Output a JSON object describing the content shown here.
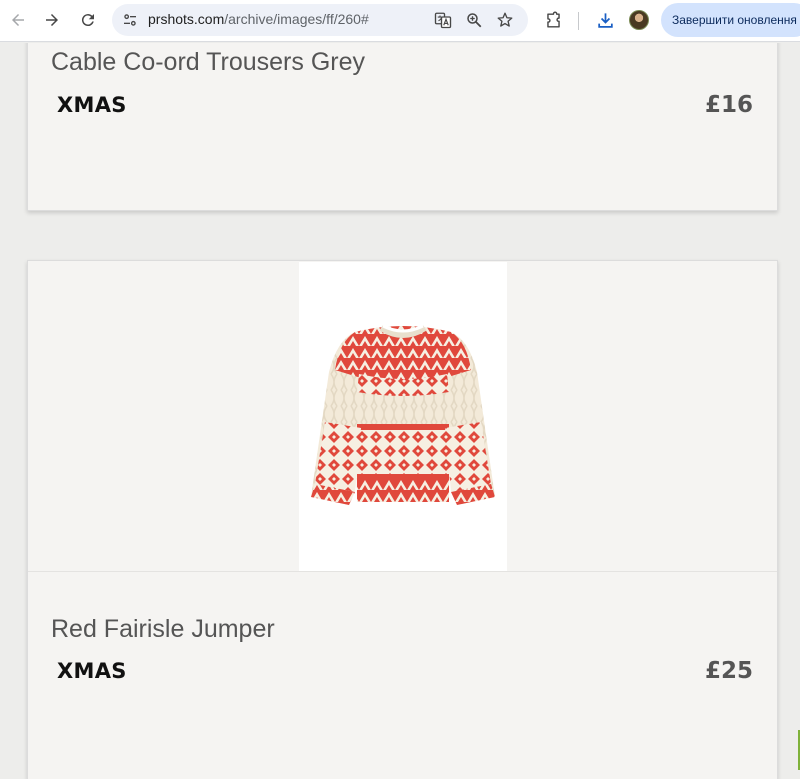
{
  "browser": {
    "url_host": "prshots.com",
    "url_path": "/archive/images/ff/260#",
    "update_button_label": "Завершити оновлення"
  },
  "products": [
    {
      "name": "Cable Co-ord Trousers Grey",
      "tag": "XMAS",
      "price": "£16"
    },
    {
      "name": "Red Fairisle Jumper",
      "tag": "XMAS",
      "price": "£25",
      "image_icon": "red-fairisle-jumper-image"
    }
  ],
  "colors": {
    "page_bg": "#ededeb",
    "card_bg": "#f5f4f2",
    "jumper_red": "#e0483c",
    "jumper_cream": "#f6efe2",
    "omnibox_bg": "#eef1f8",
    "update_btn_bg": "#d3e3fd"
  }
}
